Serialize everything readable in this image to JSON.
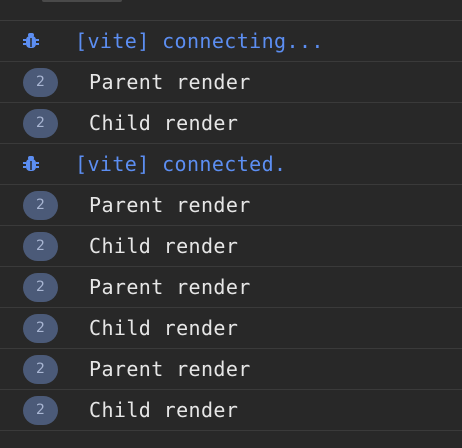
{
  "console": {
    "rows": [
      {
        "kind": "info",
        "icon": "bug-icon",
        "text": "[vite] connecting..."
      },
      {
        "kind": "log",
        "count": "2",
        "text": "Parent render"
      },
      {
        "kind": "log",
        "count": "2",
        "text": "Child render"
      },
      {
        "kind": "info",
        "icon": "bug-icon",
        "text": "[vite] connected."
      },
      {
        "kind": "log",
        "count": "2",
        "text": "Parent render"
      },
      {
        "kind": "log",
        "count": "2",
        "text": "Child render"
      },
      {
        "kind": "log",
        "count": "2",
        "text": "Parent render"
      },
      {
        "kind": "log",
        "count": "2",
        "text": "Child render"
      },
      {
        "kind": "log",
        "count": "2",
        "text": "Parent render"
      },
      {
        "kind": "log",
        "count": "2",
        "text": "Child render"
      }
    ]
  },
  "colors": {
    "background": "#282828",
    "info_text": "#5c8ef2",
    "log_text": "#e6e6e6",
    "badge_bg": "#4b5a78",
    "badge_text": "#a9b6d3",
    "divider": "#3a3a3a"
  }
}
